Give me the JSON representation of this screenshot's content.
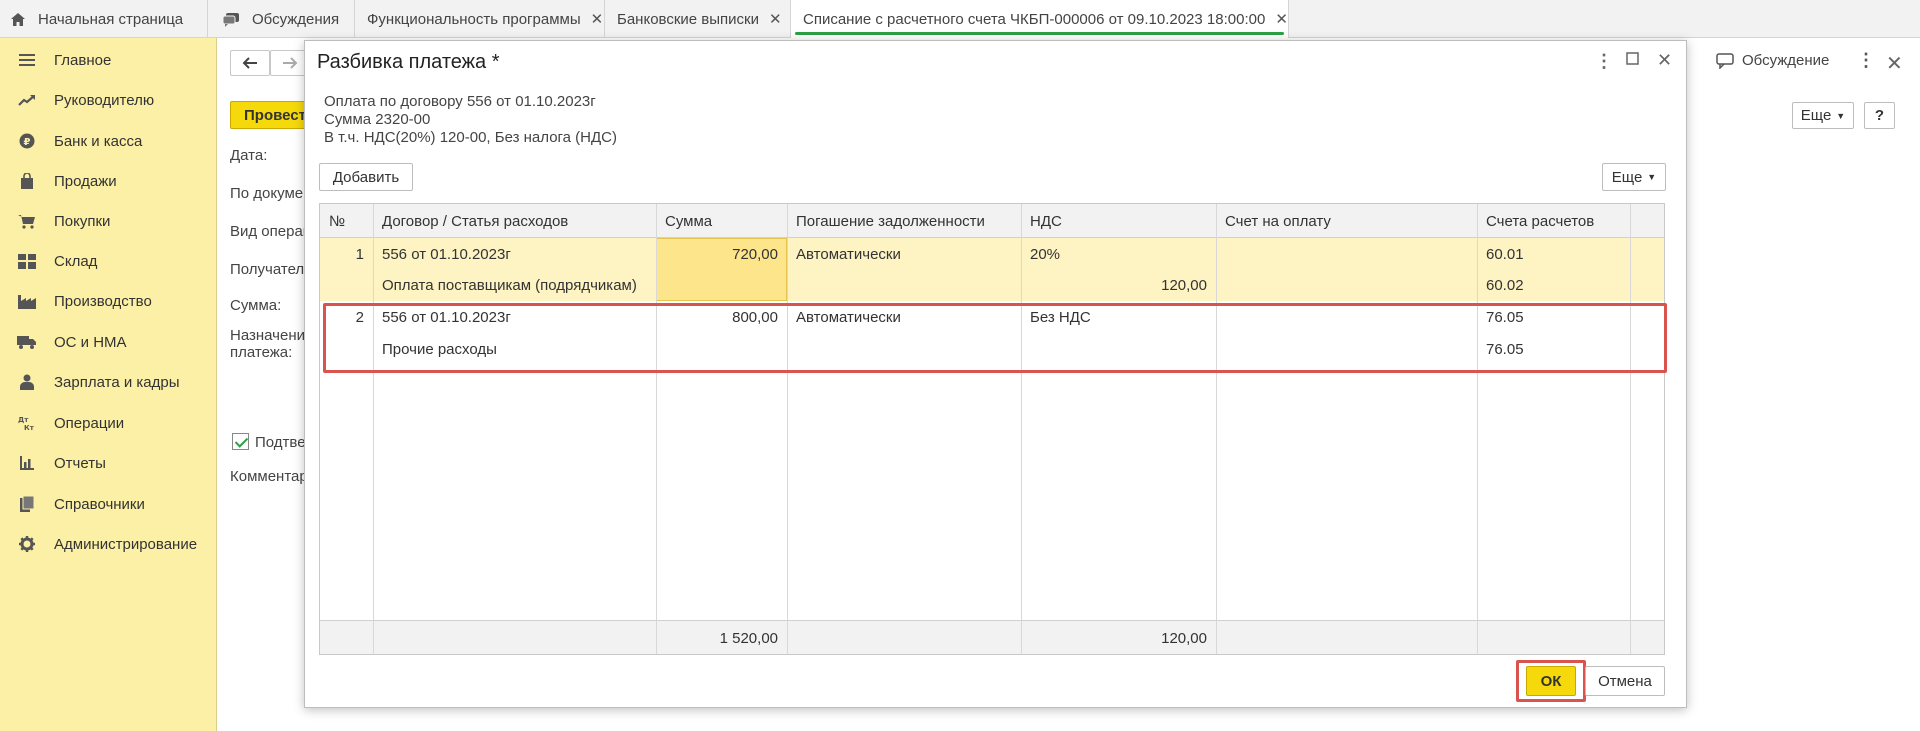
{
  "tabs": [
    {
      "label": "Начальная страница",
      "icon": "home-icon",
      "closable": false
    },
    {
      "label": "Обсуждения",
      "icon": "chat-icon",
      "closable": false
    },
    {
      "label": "Функциональность программы",
      "closable": true
    },
    {
      "label": "Банковские выписки",
      "closable": true
    },
    {
      "label": "Списание с расчетного счета ЧКБП-000006 от 09.10.2023 18:00:00",
      "closable": true,
      "active": true
    }
  ],
  "sidebar": {
    "items": [
      {
        "label": "Главное",
        "icon": "menu-lines-icon"
      },
      {
        "label": "Руководителю",
        "icon": "trend-icon"
      },
      {
        "label": "Банк и касса",
        "icon": "ruble-coin-icon"
      },
      {
        "label": "Продажи",
        "icon": "shopping-bag-icon"
      },
      {
        "label": "Покупки",
        "icon": "cart-icon"
      },
      {
        "label": "Склад",
        "icon": "warehouse-icon"
      },
      {
        "label": "Производство",
        "icon": "factory-icon"
      },
      {
        "label": "ОС и НМА",
        "icon": "truck-icon"
      },
      {
        "label": "Зарплата и кадры",
        "icon": "person-icon"
      },
      {
        "label": "Операции",
        "icon": "dt-kt-icon"
      },
      {
        "label": "Отчеты",
        "icon": "bar-chart-icon"
      },
      {
        "label": "Справочники",
        "icon": "books-icon"
      },
      {
        "label": "Администрирование",
        "icon": "gear-icon"
      }
    ]
  },
  "bgform": {
    "post_label": "Провести",
    "labels": [
      "Дата:",
      "По документу",
      "Вид операции",
      "Получатель",
      "Сумма:",
      "Назначение",
      "платежа:",
      "Подтверждено",
      "Комментарий"
    ],
    "discuss_label": "Обсуждение",
    "more_label": "Еще",
    "help_label": "?"
  },
  "modal": {
    "title": "Разбивка платежа *",
    "info_line1": "Оплата по договору 556 от 01.10.2023г",
    "info_line2": "Сумма 2320-00",
    "info_line3": "В т.ч. НДС(20%) 120-00, Без налога (НДС)",
    "add_label": "Добавить",
    "more_label": "Еще",
    "ok_label": "ОК",
    "cancel_label": "Отмена",
    "columns": [
      "№",
      "Договор / Статья расходов",
      "Сумма",
      "Погашение задолженности",
      "НДС",
      "Счет на оплату",
      "Счета расчетов"
    ],
    "rows": [
      {
        "num": "1",
        "contract": "556 от 01.10.2023г",
        "article": "Оплата поставщикам (подрядчикам)",
        "sum": "720,00",
        "repay": "Автоматически",
        "vat_rate": "20%",
        "vat_sum": "120,00",
        "invoice": "",
        "acc1": "60.01",
        "acc2": "60.02"
      },
      {
        "num": "2",
        "contract": "556 от 01.10.2023г",
        "article": "Прочие расходы",
        "sum": "800,00",
        "repay": "Автоматически",
        "vat_rate": "Без НДС",
        "vat_sum": "",
        "invoice": "",
        "acc1": "76.05",
        "acc2": "76.05"
      }
    ],
    "totals": {
      "sum": "1 520,00",
      "vat": "120,00"
    }
  }
}
